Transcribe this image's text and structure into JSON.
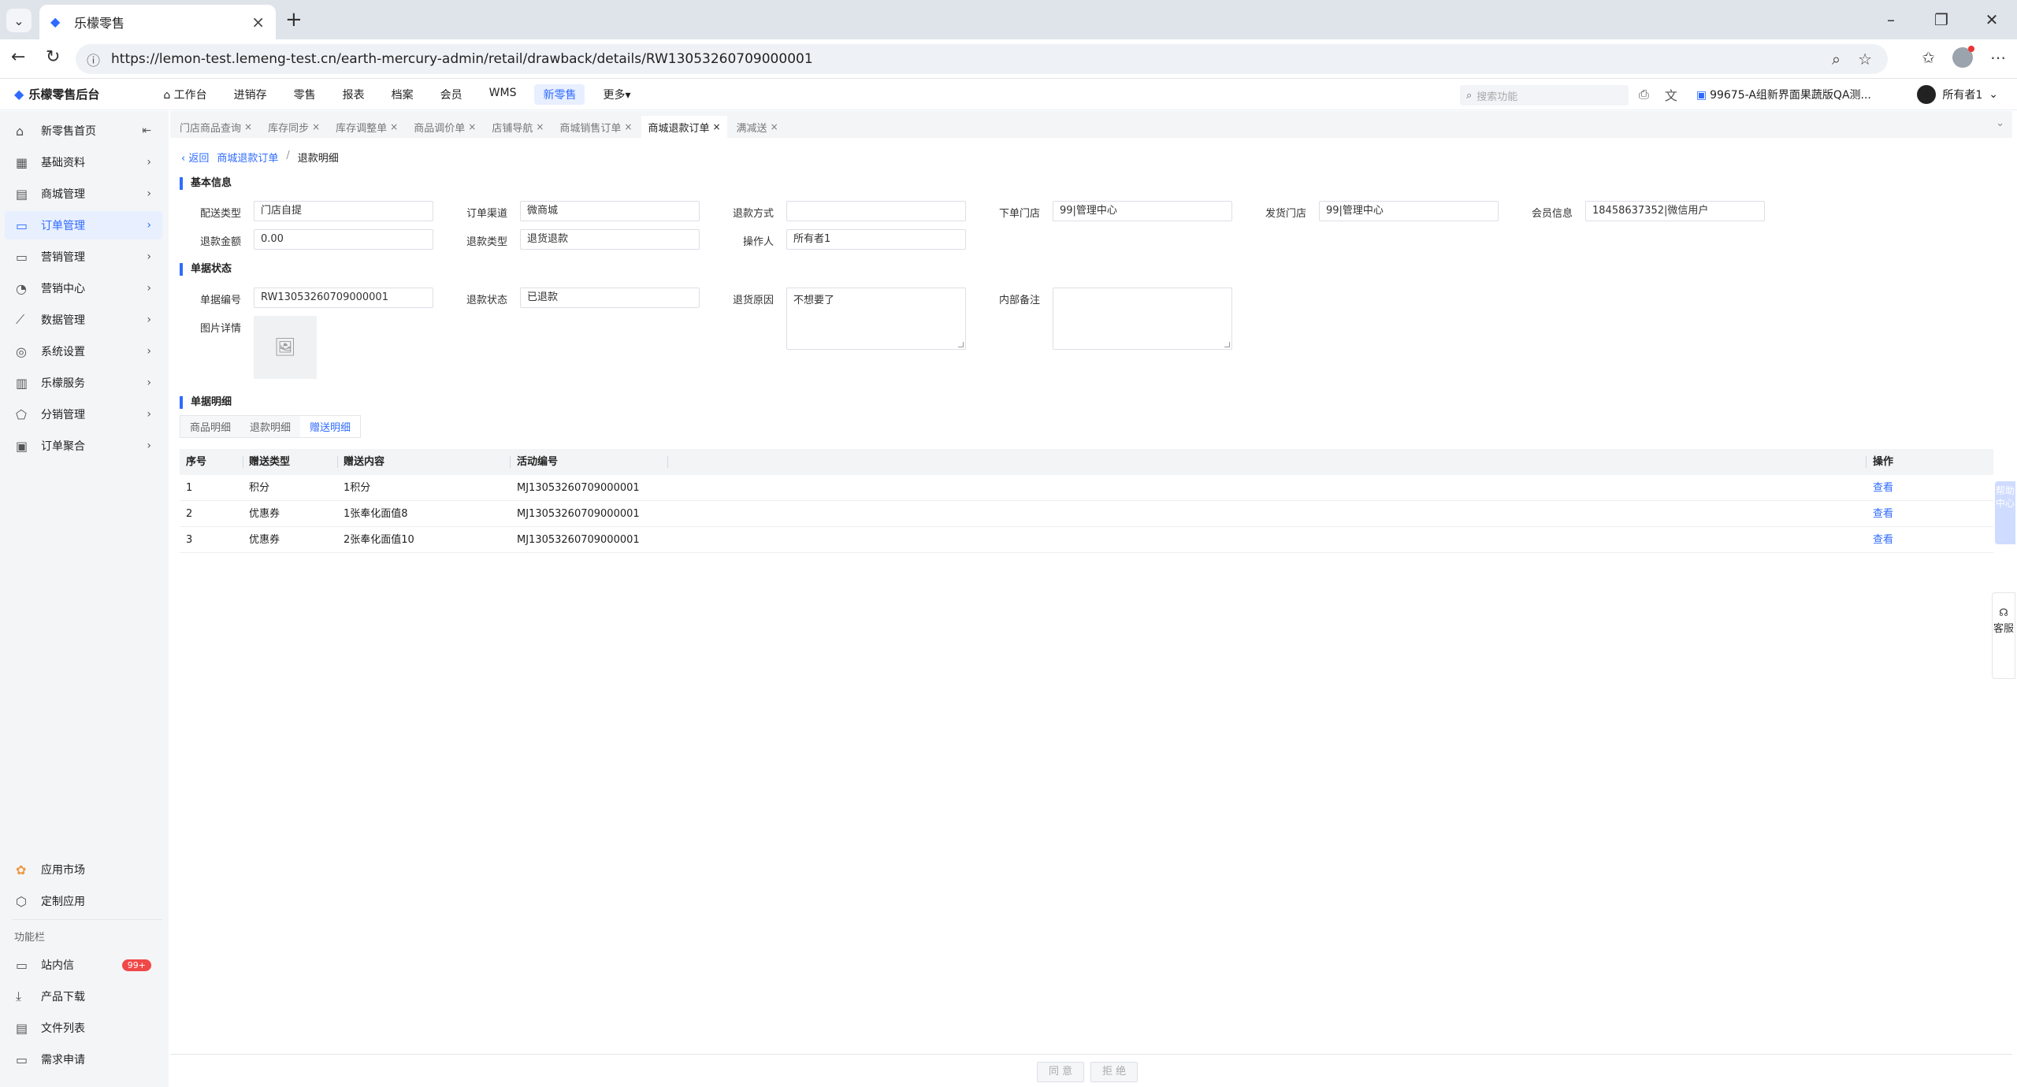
{
  "browser": {
    "tab_title": "乐檬零售",
    "url": "https://lemon-test.lemeng-test.cn/earth-mercury-admin/retail/drawback/details/RW13053260709000001"
  },
  "app": {
    "brand": "乐檬零售后台",
    "top_menu": [
      "工作台",
      "进销存",
      "零售",
      "报表",
      "档案",
      "会员",
      "WMS",
      "新零售",
      "更多"
    ],
    "search_placeholder": "搜索功能",
    "org": "99675-A组新界面果蔬版QA测...",
    "user": "所有者1"
  },
  "sidebar": {
    "items": [
      "新零售首页",
      "基础资料",
      "商城管理",
      "订单管理",
      "营销管理",
      "营销中心",
      "数据管理",
      "系统设置",
      "乐檬服务",
      "分销管理",
      "订单聚合"
    ],
    "bottom": [
      "应用市场",
      "定制应用"
    ],
    "section_label": "功能栏",
    "func": [
      "站内信",
      "产品下载",
      "文件列表",
      "需求申请"
    ],
    "badge": "99+"
  },
  "page_tabs": [
    "门店商品查询",
    "库存同步",
    "库存调整单",
    "商品调价单",
    "店铺导航",
    "商城销售订单",
    "商城退款订单",
    "满减送"
  ],
  "breadcrumb": {
    "back": "返回",
    "parent": "商城退款订单",
    "current": "退款明细"
  },
  "basic": {
    "title": "基本信息",
    "fields": [
      {
        "label": "配送类型",
        "value": "门店自提"
      },
      {
        "label": "订单渠道",
        "value": "微商城"
      },
      {
        "label": "退款方式",
        "value": ""
      },
      {
        "label": "下单门店",
        "value": "99|管理中心"
      },
      {
        "label": "发货门店",
        "value": "99|管理中心"
      },
      {
        "label": "会员信息",
        "value": "18458637352|微信用户"
      },
      {
        "label": "退款金额",
        "value": "0.00"
      },
      {
        "label": "退款类型",
        "value": "退货退款"
      },
      {
        "label": "操作人",
        "value": "所有者1"
      }
    ]
  },
  "status": {
    "title": "单据状态",
    "doc_no_label": "单据编号",
    "doc_no": "RW13053260709000001",
    "state_label": "退款状态",
    "state": "已退款",
    "reason_label": "退货原因",
    "reason": "不想要了",
    "memo_label": "内部备注",
    "memo": "",
    "img_label": "图片详情"
  },
  "detail": {
    "title": "单据明细",
    "tabs": [
      "商品明细",
      "退款明细",
      "赠送明细"
    ],
    "columns": [
      "序号",
      "赠送类型",
      "赠送内容",
      "活动编号",
      "操作"
    ],
    "rows": [
      {
        "no": "1",
        "type": "积分",
        "content": "1积分",
        "activity": "MJ13053260709000001",
        "op": "查看"
      },
      {
        "no": "2",
        "type": "优惠券",
        "content": "1张奉化面值8",
        "activity": "MJ13053260709000001",
        "op": "查看"
      },
      {
        "no": "3",
        "type": "优惠券",
        "content": "2张奉化面值10",
        "activity": "MJ13053260709000001",
        "op": "查看"
      }
    ]
  },
  "footer": {
    "agree": "同 意",
    "reject": "拒 绝"
  },
  "float": {
    "help": "帮助中心",
    "kefu": "客服"
  }
}
